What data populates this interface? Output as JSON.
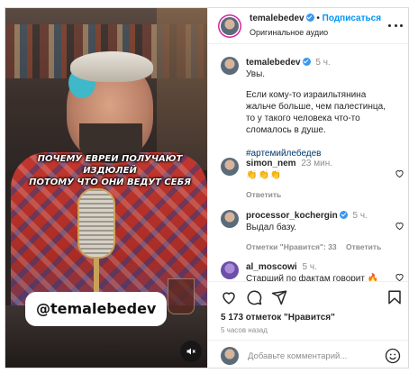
{
  "video": {
    "caption_lines": [
      "ПОЧЕМУ ЕВРЕИ ПОЛУЧАЮТ ИЗДЮЛЕЙ",
      "ПОТОМУ ЧТО ОНИ ВЕДУТ СЕБЯ"
    ],
    "watermark": "@temalebedev",
    "mute_icon": "speaker-muted-icon"
  },
  "header": {
    "username": "temalebedev",
    "separator": "•",
    "follow_label": "Подписаться",
    "audio_label": "Оригинальное аудио",
    "more_icon": "more-horizontal-icon"
  },
  "caption": {
    "username": "temalebedev",
    "time": "5 ч.",
    "line1": "Увы.",
    "line2": "Если кому-то израильтянина жальче больше, чем палестинца, то у такого человека что-то сломалось в душе.",
    "hashtag": "#артемийлебедев"
  },
  "comments": [
    {
      "username": "simon_nem",
      "time": "23 мин.",
      "text": "👏👏👏",
      "reply_label": "Ответить"
    },
    {
      "username": "processor_kochergin",
      "time": "5 ч.",
      "text": "Выдал базу.",
      "likes_label": "Отметки \"Нравится\": 33",
      "reply_label": "Ответить"
    },
    {
      "username": "al_moscowi",
      "time": "5 ч.",
      "text": "Старший по фактам говорит 🔥"
    }
  ],
  "actions": {
    "likes": "5 173 отметок \"Нравится\"",
    "posted": "5 часов назад",
    "comment_placeholder": "Добавьте комментарий...",
    "icons": [
      "heart-icon",
      "comment-icon",
      "share-icon",
      "bookmark-icon",
      "emoji-icon"
    ]
  },
  "colors": {
    "accent": "#0095f6",
    "hashtag": "#00376b",
    "muted_text": "#8e8e8e",
    "verified": "#3897f0",
    "border": "#dbdbdb"
  }
}
